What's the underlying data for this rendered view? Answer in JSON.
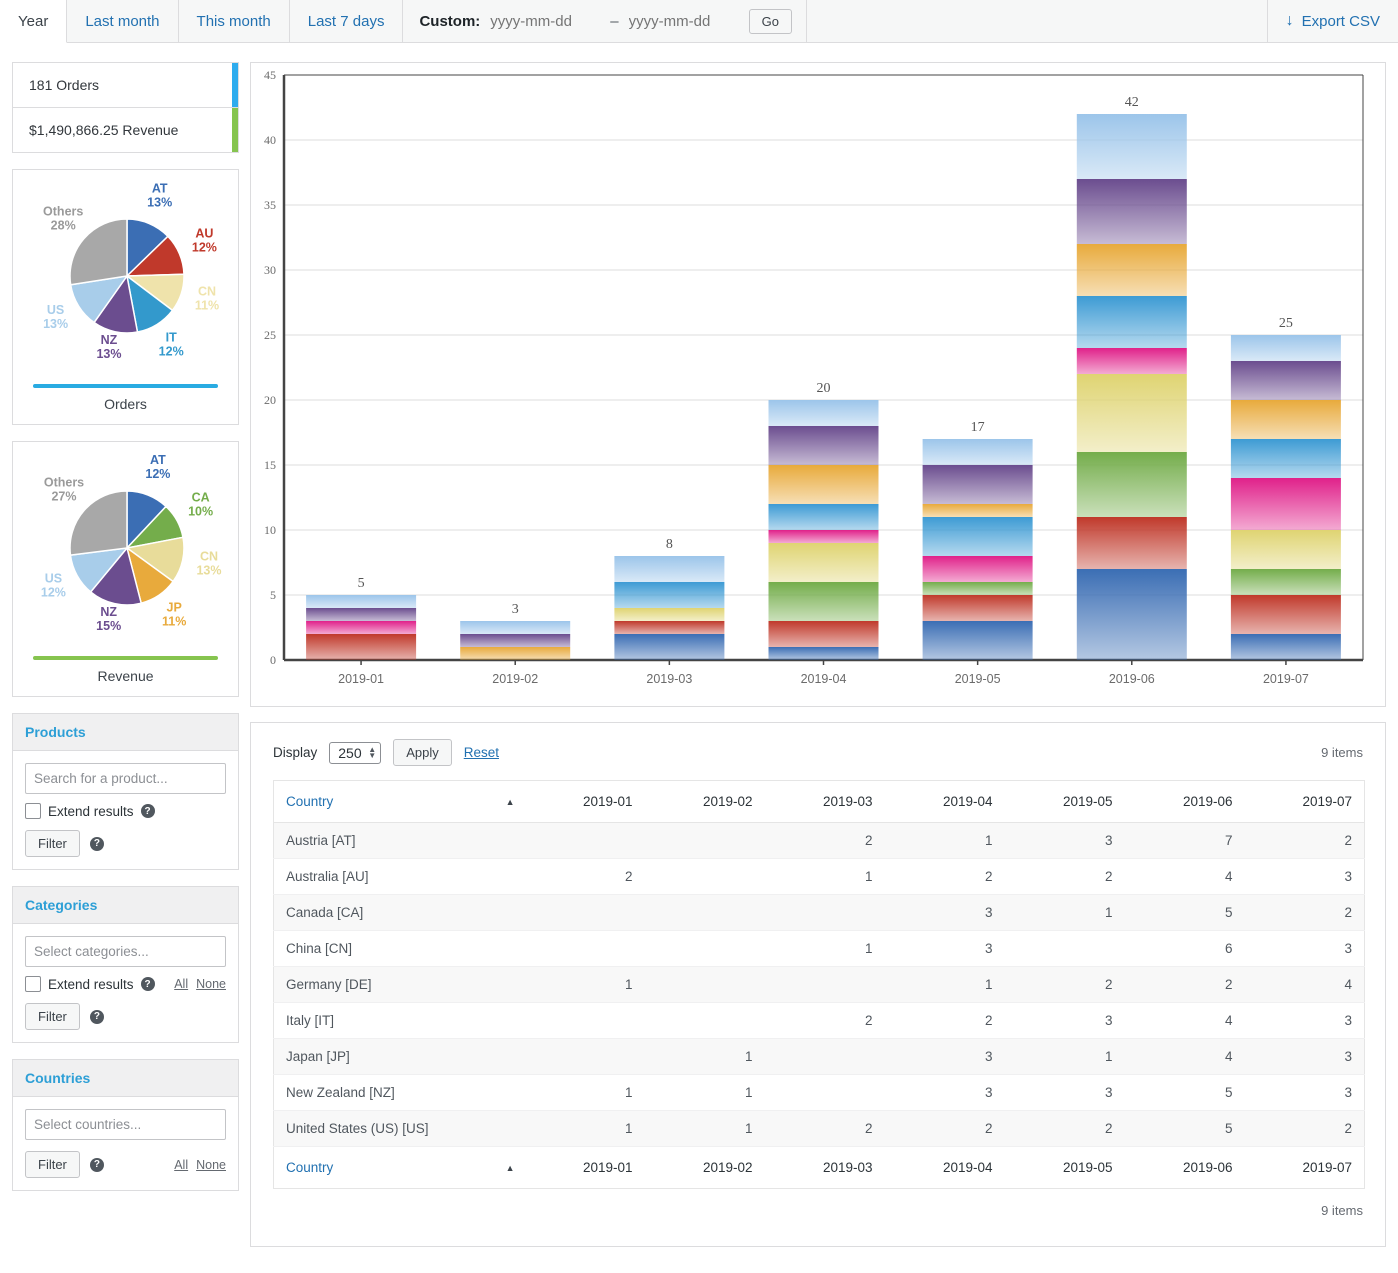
{
  "topbar": {
    "tabs": [
      {
        "label": "Year",
        "active": true
      },
      {
        "label": "Last month",
        "active": false
      },
      {
        "label": "This month",
        "active": false
      },
      {
        "label": "Last 7 days",
        "active": false
      }
    ],
    "custom_label": "Custom:",
    "date_from_placeholder": "yyyy-mm-dd",
    "date_to_placeholder": "yyyy-mm-dd",
    "date_from_value": "",
    "date_to_value": "",
    "dash": "–",
    "go_label": "Go",
    "export_label": "Export CSV",
    "export_icon": "↓"
  },
  "summary": {
    "orders": "181 Orders",
    "orders_color": "#2eacee",
    "revenue": "$1,490,866.25 Revenue",
    "revenue_color": "#86c44f"
  },
  "pies": [
    {
      "caption": "Orders",
      "rule_color": "#29abe2",
      "slices": [
        {
          "code": "AT",
          "pct": "13%",
          "value": 13,
          "color": "#3b6eb4"
        },
        {
          "code": "AU",
          "pct": "12%",
          "value": 12,
          "color": "#c0392b"
        },
        {
          "code": "CN",
          "pct": "11%",
          "value": 11,
          "color": "#efe3ab"
        },
        {
          "code": "IT",
          "pct": "12%",
          "value": 12,
          "color": "#3399cc"
        },
        {
          "code": "NZ",
          "pct": "13%",
          "value": 13,
          "color": "#6b4d8f"
        },
        {
          "code": "US",
          "pct": "13%",
          "value": 13,
          "color": "#a8cdea"
        },
        {
          "code": "Others",
          "pct": "28%",
          "value": 28,
          "color": "#a8a8a8"
        }
      ]
    },
    {
      "caption": "Revenue",
      "rule_color": "#86c44f",
      "slices": [
        {
          "code": "AT",
          "pct": "12%",
          "value": 12,
          "color": "#3b6eb4"
        },
        {
          "code": "CA",
          "pct": "10%",
          "value": 10,
          "color": "#74ad4b"
        },
        {
          "code": "CN",
          "pct": "13%",
          "value": 13,
          "color": "#e8dc9a"
        },
        {
          "code": "JP",
          "pct": "11%",
          "value": 11,
          "color": "#e8aa3c"
        },
        {
          "code": "NZ",
          "pct": "15%",
          "value": 15,
          "color": "#6b4d8f"
        },
        {
          "code": "US",
          "pct": "12%",
          "value": 12,
          "color": "#a8cdea"
        },
        {
          "code": "Others",
          "pct": "27%",
          "value": 27,
          "color": "#a8a8a8"
        }
      ]
    }
  ],
  "panels": [
    {
      "title": "Products",
      "input_placeholder": "Search for a product...",
      "input_value": "",
      "extend_label": "Extend results",
      "has_extend": true,
      "has_allnone": false,
      "all_label": "All",
      "none_label": "None",
      "filter_label": "Filter"
    },
    {
      "title": "Categories",
      "input_placeholder": "Select categories...",
      "input_value": "",
      "extend_label": "Extend results",
      "has_extend": true,
      "has_allnone": true,
      "all_label": "All",
      "none_label": "None",
      "filter_label": "Filter"
    },
    {
      "title": "Countries",
      "input_placeholder": "Select countries...",
      "input_value": "",
      "extend_label": "",
      "has_extend": false,
      "has_allnone": true,
      "all_label": "All",
      "none_label": "None",
      "filter_label": "Filter"
    }
  ],
  "table_toolbar": {
    "display_label": "Display",
    "display_value": "250",
    "apply_label": "Apply",
    "reset_label": "Reset",
    "items_count": "9 items",
    "items_count_bottom": "9 items"
  },
  "table": {
    "country_header": "Country",
    "sort_arrow": "▲",
    "columns": [
      "2019-01",
      "2019-02",
      "2019-03",
      "2019-04",
      "2019-05",
      "2019-06",
      "2019-07"
    ],
    "rows": [
      {
        "country": "Austria [AT]",
        "values": [
          "",
          "",
          "2",
          "1",
          "3",
          "7",
          "2"
        ]
      },
      {
        "country": "Australia [AU]",
        "values": [
          "2",
          "",
          "1",
          "2",
          "2",
          "4",
          "3"
        ]
      },
      {
        "country": "Canada [CA]",
        "values": [
          "",
          "",
          "",
          "3",
          "1",
          "5",
          "2"
        ]
      },
      {
        "country": "China [CN]",
        "values": [
          "",
          "",
          "1",
          "3",
          "",
          "6",
          "3"
        ]
      },
      {
        "country": "Germany [DE]",
        "values": [
          "1",
          "",
          "",
          "1",
          "2",
          "2",
          "4"
        ]
      },
      {
        "country": "Italy [IT]",
        "values": [
          "",
          "",
          "2",
          "2",
          "3",
          "4",
          "3"
        ]
      },
      {
        "country": "Japan [JP]",
        "values": [
          "",
          "1",
          "",
          "3",
          "1",
          "4",
          "3"
        ]
      },
      {
        "country": "New Zealand [NZ]",
        "values": [
          "1",
          "1",
          "",
          "3",
          "3",
          "5",
          "3"
        ]
      },
      {
        "country": "United States (US) [US]",
        "values": [
          "1",
          "1",
          "2",
          "2",
          "2",
          "5",
          "2"
        ]
      }
    ]
  },
  "chart_data": {
    "type": "bar",
    "stacked": true,
    "title": "",
    "xlabel": "",
    "ylabel": "",
    "ylim": [
      0,
      45
    ],
    "yticks": [
      0,
      5,
      10,
      15,
      20,
      25,
      30,
      35,
      40,
      45
    ],
    "grid": true,
    "categories": [
      "2019-01",
      "2019-02",
      "2019-03",
      "2019-04",
      "2019-05",
      "2019-06",
      "2019-07"
    ],
    "totals": [
      5,
      3,
      8,
      20,
      17,
      42,
      25
    ],
    "series": [
      {
        "name": "Austria [AT]",
        "code": "AT",
        "color": "#3b6eb4",
        "values": [
          0,
          0,
          2,
          1,
          3,
          7,
          2
        ]
      },
      {
        "name": "Australia [AU]",
        "code": "AU",
        "color": "#c0392b",
        "values": [
          2,
          0,
          1,
          2,
          2,
          4,
          3
        ]
      },
      {
        "name": "Canada [CA]",
        "code": "CA",
        "color": "#74ad4b",
        "values": [
          0,
          0,
          0,
          3,
          1,
          5,
          2
        ]
      },
      {
        "name": "China [CN]",
        "code": "CN",
        "color": "#dfd472",
        "values": [
          0,
          0,
          1,
          3,
          0,
          6,
          3
        ]
      },
      {
        "name": "Germany [DE]",
        "code": "DE",
        "color": "#e0218a",
        "values": [
          1,
          0,
          0,
          1,
          2,
          2,
          4
        ]
      },
      {
        "name": "Italy [IT]",
        "code": "IT",
        "color": "#3d9bd4",
        "values": [
          0,
          0,
          2,
          2,
          3,
          4,
          3
        ]
      },
      {
        "name": "Japan [JP]",
        "code": "JP",
        "color": "#e8aa3c",
        "values": [
          0,
          1,
          0,
          3,
          1,
          4,
          3
        ]
      },
      {
        "name": "New Zealand [NZ]",
        "code": "NZ",
        "color": "#6b4d8f",
        "values": [
          1,
          1,
          0,
          3,
          3,
          5,
          3
        ]
      },
      {
        "name": "United States (US) [US]",
        "code": "US",
        "color": "#9cc5ea",
        "values": [
          1,
          1,
          2,
          2,
          2,
          5,
          2
        ]
      }
    ]
  }
}
